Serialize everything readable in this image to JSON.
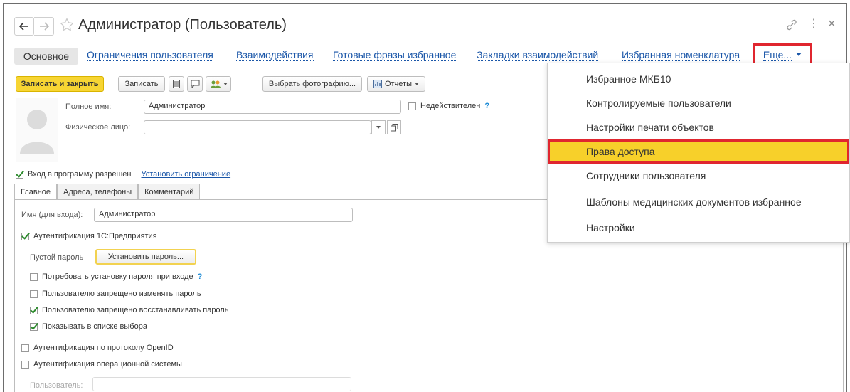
{
  "window": {
    "title": "Администратор (Пользователь)"
  },
  "top_tabs": [
    {
      "label": "Основное"
    },
    {
      "label": "Ограничения пользователя"
    },
    {
      "label": "Взаимодействия"
    },
    {
      "label": "Готовые фразы избранное"
    },
    {
      "label": "Закладки взаимодействий"
    },
    {
      "label": "Избранная номенклатура"
    },
    {
      "label": "Еще..."
    }
  ],
  "toolbar": {
    "save_close": "Записать и закрыть",
    "save": "Записать",
    "choose_photo": "Выбрать фотографию...",
    "reports": "Отчеты"
  },
  "form": {
    "full_name_label": "Полное имя:",
    "full_name_value": "Администратор",
    "inactive_label": "Недействителен",
    "help": "?",
    "person_label": "Физическое лицо:",
    "person_value": "",
    "login_allowed_label": "Вход в программу разрешен",
    "set_restriction_link": "Установить ограничение"
  },
  "inner_tabs": [
    {
      "label": "Главное"
    },
    {
      "label": "Адреса, телефоны"
    },
    {
      "label": "Комментарий"
    }
  ],
  "main": {
    "login_name_label": "Имя (для входа):",
    "login_name_value": "Администратор",
    "auth_1c_label": "Аутентификация 1С:Предприятия",
    "empty_password_label": "Пустой пароль",
    "set_password_btn": "Установить пароль...",
    "require_password_label": "Потребовать установку пароля при входе",
    "forbid_change_label": "Пользователю запрещено изменять пароль",
    "forbid_restore_label": "Пользователю запрещено восстанавливать пароль",
    "show_in_list_label": "Показывать в списке выбора",
    "openid_label": "Аутентификация по протоколу OpenID",
    "os_auth_label": "Аутентификация операционной системы",
    "os_user_label": "Пользователь:",
    "os_user_value": ""
  },
  "more_menu": {
    "items": [
      {
        "label": "Избранное МКБ10"
      },
      {
        "label": "Контролируемые пользователи"
      },
      {
        "label": "Настройки печати объектов"
      },
      {
        "label": "Права доступа"
      },
      {
        "label": "Сотрудники пользователя"
      },
      {
        "label": "Шаблоны медицинских документов избранное"
      },
      {
        "label": "Настройки"
      }
    ]
  },
  "colors": {
    "accent_yellow": "#f7d02a",
    "highlight_red": "#e0262f",
    "link_blue": "#1a56a8"
  }
}
